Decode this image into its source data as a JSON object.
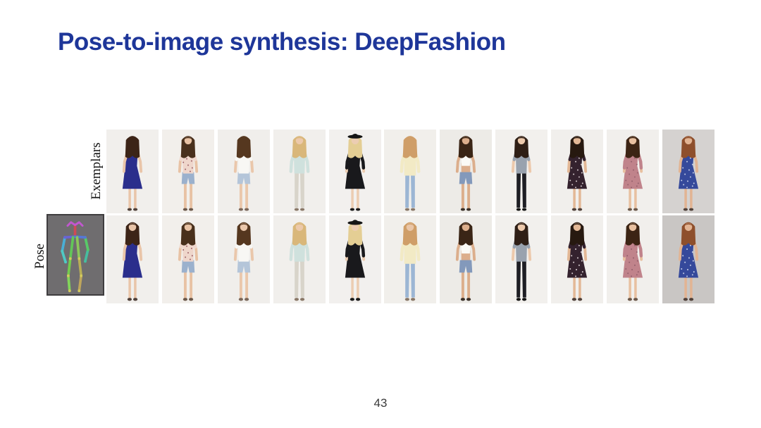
{
  "slide": {
    "title": "Pose-to-image synthesis: DeepFashion",
    "title_color": "#1e3699",
    "background": "#ffffff",
    "page_number": "43"
  },
  "figure": {
    "row_labels": {
      "exemplars": "Exemplars",
      "pose": "Pose"
    },
    "pose_box": {
      "background": "#6f6d6f",
      "border": "#3f3d3f",
      "skeleton_colors": {
        "head": "#c157cf",
        "neck": "#cf4a55",
        "shoulder_left": "#6a62d4",
        "shoulder_right": "#5577d6",
        "upper_arm_left": "#4aaed6",
        "forearm_left": "#4ec9c4",
        "upper_arm_right": "#58c968",
        "forearm_right": "#46bda0",
        "torso_left": "#62c758",
        "torso_right": "#8cc85a",
        "thigh_left": "#74cc4e",
        "shin_left": "#82d65a",
        "thigh_right": "#b8ae56",
        "shin_right": "#bfa65c",
        "joints": "#d2c95e"
      }
    },
    "columns": [
      {
        "desc": "navy blue sleeveless skater dress",
        "exemplar_view": "back",
        "generated_view": "front",
        "bg": "#f1efec",
        "skin": "#e9c5a9",
        "hair": "#3c2417",
        "garment": "dress",
        "sleeves": "none",
        "top_color": "#2a2e8c",
        "bottom": null,
        "bottom_color": null,
        "speckle": null,
        "hat": false,
        "shoe": "#50413a"
      },
      {
        "desc": "pale pink floral tee with denim shorts",
        "exemplar_view": "front",
        "generated_view": "front",
        "bg": "#f2efeb",
        "skin": "#e8c2a4",
        "hair": "#49301c",
        "garment": "top",
        "sleeves": "short",
        "top_color": "#efd6cb",
        "bottom": "shorts",
        "bottom_color": "#9bb1cd",
        "speckle": "#9c6066",
        "hat": false,
        "shoe": "#6b584a"
      },
      {
        "desc": "white tee with light denim shorts",
        "exemplar_view": "back",
        "generated_view": "front",
        "bg": "#f0eeeb",
        "skin": "#eac7ab",
        "hair": "#55371f",
        "garment": "top",
        "sleeves": "short",
        "top_color": "#f8f7f4",
        "bottom": "shorts",
        "bottom_color": "#b4c5d9",
        "speckle": null,
        "hat": false,
        "shoe": "#7a675a"
      },
      {
        "desc": "mint long-sleeve top with light acid-wash jeans",
        "exemplar_view": "front",
        "generated_view": "front",
        "bg": "#f1efec",
        "skin": "#ecc9ab",
        "hair": "#d9b77a",
        "garment": "top",
        "sleeves": "long",
        "top_color": "#cfe1dd",
        "bottom": "pants",
        "bottom_color": "#d8d4ca",
        "speckle": null,
        "hat": false,
        "shoe": "#8a7868"
      },
      {
        "desc": "black shift dress with black wide-brim hat",
        "exemplar_view": "side",
        "generated_view": "front",
        "bg": "#f2f0ee",
        "skin": "#eccdb2",
        "hair": "#e4ce94",
        "garment": "dress",
        "sleeves": "threequarter",
        "top_color": "#19191c",
        "bottom": null,
        "bottom_color": null,
        "speckle": null,
        "hat": true,
        "shoe": "#1a1a1a"
      },
      {
        "desc": "cream knit sweater with blue jeans",
        "exemplar_view": "back",
        "generated_view": "front",
        "bg": "#f1efeb",
        "skin": "#eac6a8",
        "hair": "#cf9e68",
        "garment": "sweater",
        "sleeves": "long",
        "top_color": "#f2eac5",
        "bottom": "pants",
        "bottom_color": "#9cb6d4",
        "speckle": null,
        "hat": false,
        "shoe": "#8a7868"
      },
      {
        "desc": "white cami crop top with high-waist denim shorts",
        "exemplar_view": "front",
        "generated_view": "front",
        "bg": "#edebe7",
        "skin": "#dcae8c",
        "hair": "#3a2516",
        "garment": "croptop",
        "sleeves": "none",
        "top_color": "#fbfaf6",
        "bottom": "shorts",
        "bottom_color": "#8399bb",
        "speckle": null,
        "hat": false,
        "shoe": "#3a3028"
      },
      {
        "desc": "gray tee with black skinny pants",
        "exemplar_view": "front",
        "generated_view": "front",
        "bg": "#f2f0ed",
        "skin": "#ecc9ac",
        "hair": "#2f1f16",
        "garment": "top",
        "sleeves": "short",
        "top_color": "#99a2ae",
        "bottom": "pants",
        "bottom_color": "#1e1e24",
        "speckle": null,
        "hat": false,
        "shoe": "#141414"
      },
      {
        "desc": "dark ditsy-floral skater dress",
        "exemplar_view": "front",
        "generated_view": "front",
        "bg": "#f1efec",
        "skin": "#e3b896",
        "hair": "#271910",
        "garment": "dress",
        "sleeves": "short",
        "top_color": "#34222e",
        "bottom": null,
        "bottom_color": null,
        "speckle": "#d9cfd2",
        "hat": false,
        "shoe": "#50413a"
      },
      {
        "desc": "mauve lace shift dress, three-quarter sleeves",
        "exemplar_view": "front",
        "generated_view": "front",
        "bg": "#f1efec",
        "skin": "#e8c0a0",
        "hair": "#3c2414",
        "garment": "dress",
        "sleeves": "threequarter",
        "top_color": "#c0838b",
        "bottom": null,
        "bottom_color": null,
        "speckle": "#94606c",
        "hat": false,
        "shoe": "#6b584a"
      },
      {
        "desc": "blue ditsy-floral sleeveless dress on gray backdrop",
        "exemplar_view": "side",
        "generated_view": "front",
        "bg": "#d5d2d0",
        "bg_generated": "#c9c6c4",
        "skin": "#e2b493",
        "hair": "#8e4f2c",
        "garment": "dress",
        "sleeves": "none",
        "top_color": "#35499b",
        "bottom": null,
        "bottom_color": null,
        "speckle": "#c7cfe7",
        "hat": false,
        "shoe": "#50413a"
      }
    ]
  }
}
